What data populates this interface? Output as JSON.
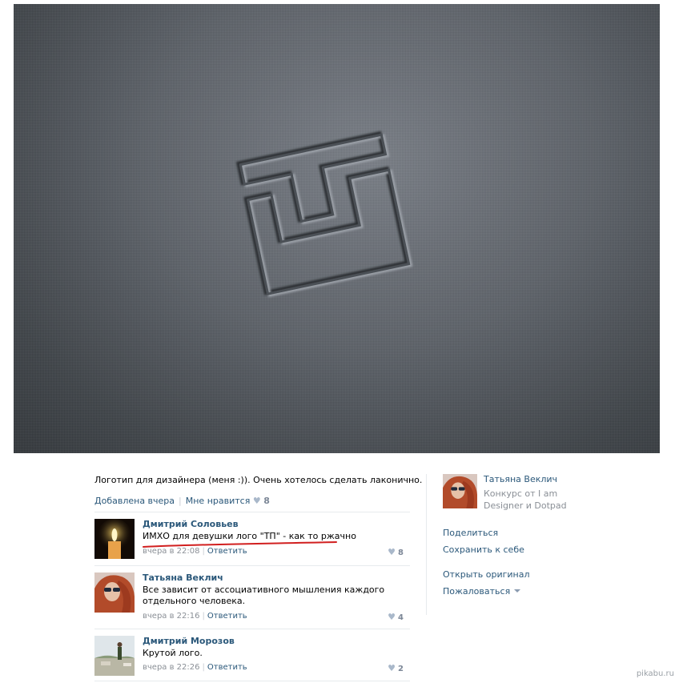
{
  "post": {
    "caption": "Логотип для дизайнера (меня :)). Очень хотелось сделать лаконично.",
    "added": "Добавлена вчера",
    "like_label": "Мне нравится",
    "like_count": "8"
  },
  "comments": [
    {
      "name": "Дмитрий Соловьев",
      "text": "ИМХО для девушки лого \"ТП\" - как то ржачно",
      "time": "вчера в 22:08",
      "reply": "Ответить",
      "likes": "8"
    },
    {
      "name": "Татьяна Веклич",
      "text": "Все зависит от ассоциативного мышления каждого отдельного человека.",
      "time": "вчера в 22:16",
      "reply": "Ответить",
      "likes": "4"
    },
    {
      "name": "Дмитрий Морозов",
      "text": "Крутой лого.",
      "time": "вчера в 22:26",
      "reply": "Ответить",
      "likes": "2"
    }
  ],
  "sidebar": {
    "author_name": "Татьяна Веклич",
    "author_sub": "Конкурс от I am Designer и Dotpad",
    "share": "Поделиться",
    "save": "Сохранить к себе",
    "open_original": "Открыть оригинал",
    "report": "Пожаловаться"
  },
  "watermark": "pikabu.ru",
  "colors": {
    "link": "#2b587a",
    "muted": "#8a8f96",
    "annotation": "#d11f1f"
  },
  "icons": [
    "heart-icon",
    "dropdown-arrow-icon",
    "logo-tp-emboss"
  ]
}
